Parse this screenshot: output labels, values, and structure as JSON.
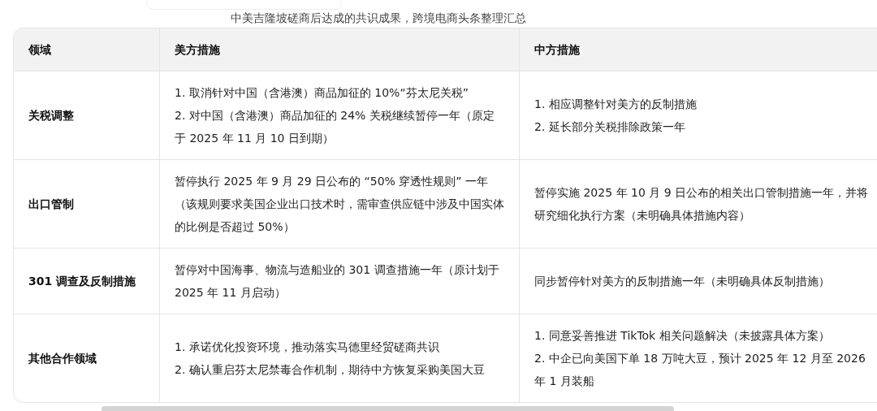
{
  "caption": "中美吉隆坡磋商后达成的共识成果，跨境电商头条整理汇总",
  "table": {
    "columns": [
      "领域",
      "美方措施",
      "中方措施"
    ],
    "rows": [
      {
        "cells": [
          {
            "lines": [
              "关税调整"
            ]
          },
          {
            "lines": [
              "1. 取消针对中国（含港澳）商品加征的 10%“芬太尼关税”",
              "2. 对中国（含港澳）商品加征的 24% 关税继续暂停一年（原定于 2025 年 11 月 10 日到期）"
            ]
          },
          {
            "lines": [
              "1. 相应调整针对美方的反制措施",
              "2. 延长部分关税排除政策一年"
            ]
          }
        ]
      },
      {
        "cells": [
          {
            "lines": [
              "出口管制"
            ]
          },
          {
            "lines": [
              "暂停执行 2025 年 9 月 29 日公布的 “50% 穿透性规则” 一年（该规则要求美国企业出口技术时，需审查供应链中涉及中国实体的比例是否超过 50%）"
            ]
          },
          {
            "lines": [
              "暂停实施 2025 年 10 月 9 日公布的相关出口管制措施一年，并将研究细化执行方案（未明确具体措施内容）"
            ]
          }
        ]
      },
      {
        "cells": [
          {
            "lines": [
              "301 调查及反制措施"
            ]
          },
          {
            "lines": [
              "暂停对中国海事、物流与造船业的 301 调查措施一年（原计划于 2025 年 11 月启动）"
            ]
          },
          {
            "lines": [
              "同步暂停针对美方的反制措施一年（未明确具体反制措施）"
            ]
          }
        ]
      },
      {
        "cells": [
          {
            "lines": [
              "其他合作领域"
            ]
          },
          {
            "lines": [
              "1. 承诺优化投资环境，推动落实马德里经贸磋商共识",
              "2. 确认重启芬太尼禁毒合作机制，期待中方恢复采购美国大豆"
            ]
          },
          {
            "lines": [
              "1. 同意妥善推进 TikTok 相关问题解决（未披露具体方案）",
              "2. 中企已向美国下单 18 万吨大豆，预计 2025 年 12 月至 2026 年 1 月装船"
            ]
          }
        ]
      }
    ]
  }
}
